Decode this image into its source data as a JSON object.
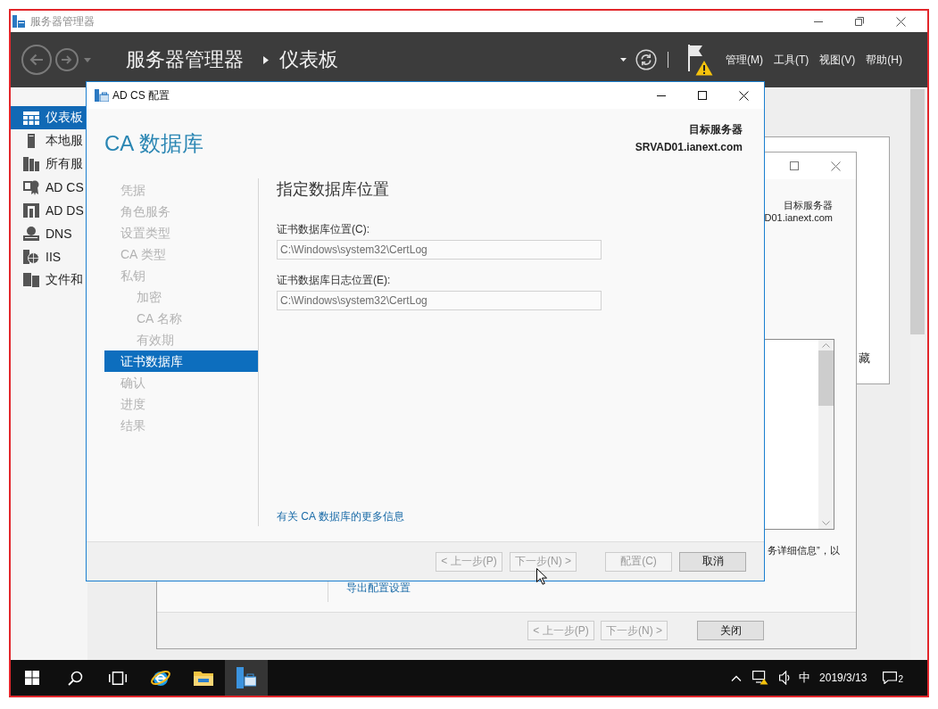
{
  "app_window": {
    "title": "服务器管理器",
    "breadcrumb": {
      "root": "服务器管理器",
      "page": "仪表板"
    },
    "has_warning": true,
    "menus": [
      "管理(M)",
      "工具(T)",
      "视图(V)",
      "帮助(H)"
    ]
  },
  "sidebar": {
    "items": [
      {
        "label": "仪表板",
        "kind": "dashboard",
        "selected": true
      },
      {
        "label": "本地服",
        "kind": "server",
        "selected": false
      },
      {
        "label": "所有服",
        "kind": "servers",
        "selected": false
      },
      {
        "label": "AD CS",
        "kind": "certificate",
        "selected": false
      },
      {
        "label": "AD DS",
        "kind": "directory",
        "selected": false
      },
      {
        "label": "DNS",
        "kind": "dns",
        "selected": false
      },
      {
        "label": "IIS",
        "kind": "iis",
        "selected": false
      },
      {
        "label": "文件和",
        "kind": "files",
        "selected": false
      }
    ]
  },
  "back_window": {
    "text": "藏"
  },
  "wizard_window": {
    "target_label": "目标服务器",
    "target_server": "D01.ianext.com",
    "note": "务详细信息”，以",
    "link": "导出配置设置",
    "buttons": [
      {
        "label": "< 上一步(P)",
        "disabled": true
      },
      {
        "label": "下一步(N) >",
        "disabled": true
      },
      {
        "label": "关闭",
        "disabled": false
      }
    ]
  },
  "dialog": {
    "title": "AD CS 配置",
    "heading": "CA 数据库",
    "target_label": "目标服务器",
    "target_server": "SRVAD01.ianext.com",
    "steps": [
      {
        "label": "凭据",
        "selected": false
      },
      {
        "label": "角色服务",
        "selected": false
      },
      {
        "label": "设置类型",
        "selected": false
      },
      {
        "label": "CA 类型",
        "selected": false
      },
      {
        "label": "私钥",
        "selected": false,
        "children": [
          {
            "label": "加密",
            "selected": false
          },
          {
            "label": "CA 名称",
            "selected": false
          },
          {
            "label": "有效期",
            "selected": false
          }
        ]
      },
      {
        "label": "证书数据库",
        "selected": true
      },
      {
        "label": "确认",
        "selected": false
      },
      {
        "label": "进度",
        "selected": false
      },
      {
        "label": "结果",
        "selected": false
      }
    ],
    "section_title": "指定数据库位置",
    "fields": [
      {
        "label": "证书数据库位置(C):",
        "value": "C:\\Windows\\system32\\CertLog",
        "disabled": true
      },
      {
        "label": "证书数据库日志位置(E):",
        "value": "C:\\Windows\\system32\\CertLog",
        "disabled": true
      }
    ],
    "link": "有关 CA 数据库的更多信息",
    "buttons": [
      {
        "label": "< 上一步(P)",
        "disabled": true
      },
      {
        "label": "下一步(N) >",
        "disabled": true
      },
      {
        "label": "配置(C)",
        "disabled": true
      },
      {
        "label": "取消",
        "disabled": false
      }
    ]
  },
  "taskbar": {
    "items": [
      {
        "kind": "start",
        "selected": false
      },
      {
        "kind": "search",
        "selected": false
      },
      {
        "kind": "task-view",
        "selected": false
      },
      {
        "kind": "browser",
        "selected": false
      },
      {
        "kind": "explorer",
        "selected": false
      },
      {
        "kind": "server-manager",
        "selected": true
      }
    ],
    "ime": "中",
    "date": "2019/3/13",
    "notification_count": "2"
  }
}
